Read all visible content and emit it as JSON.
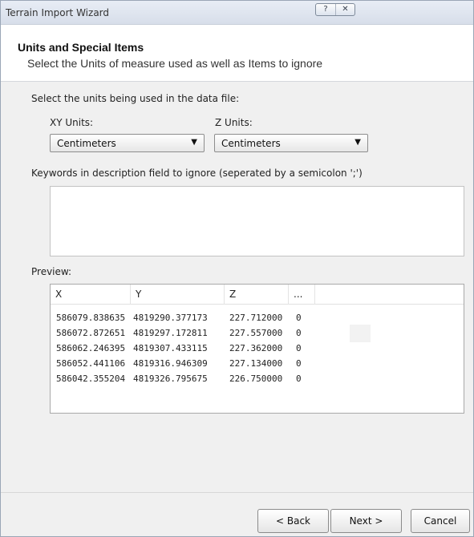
{
  "window": {
    "title": "Terrain Import Wizard",
    "controls": {
      "help": "?",
      "close": "✕"
    }
  },
  "header": {
    "title": "Units and Special Items",
    "subtitle": "Select the Units of measure used as well as Items to ignore"
  },
  "units_section": {
    "label": "Select the units being used in the data file:",
    "xy_label": "XY Units:",
    "xy_value": "Centimeters",
    "z_label": "Z Units:",
    "z_value": "Centimeters"
  },
  "keywords_section": {
    "label": "Keywords in description field to ignore (seperated by a semicolon ';')",
    "value": ""
  },
  "preview": {
    "label": "Preview:",
    "columns": [
      "X",
      "Y",
      "Z",
      "..."
    ],
    "rows": [
      [
        "586079.838635",
        "4819290.377173",
        "227.712000",
        "0"
      ],
      [
        "586072.872651",
        "4819297.172811",
        "227.557000",
        "0"
      ],
      [
        "586062.246395",
        "4819307.433115",
        "227.362000",
        "0"
      ],
      [
        "586052.441106",
        "4819316.946309",
        "227.134000",
        "0"
      ],
      [
        "586042.355204",
        "4819326.795675",
        "226.750000",
        "0"
      ]
    ]
  },
  "footer": {
    "back_label": "< Back",
    "next_label": "Next >",
    "cancel_label": "Cancel"
  }
}
